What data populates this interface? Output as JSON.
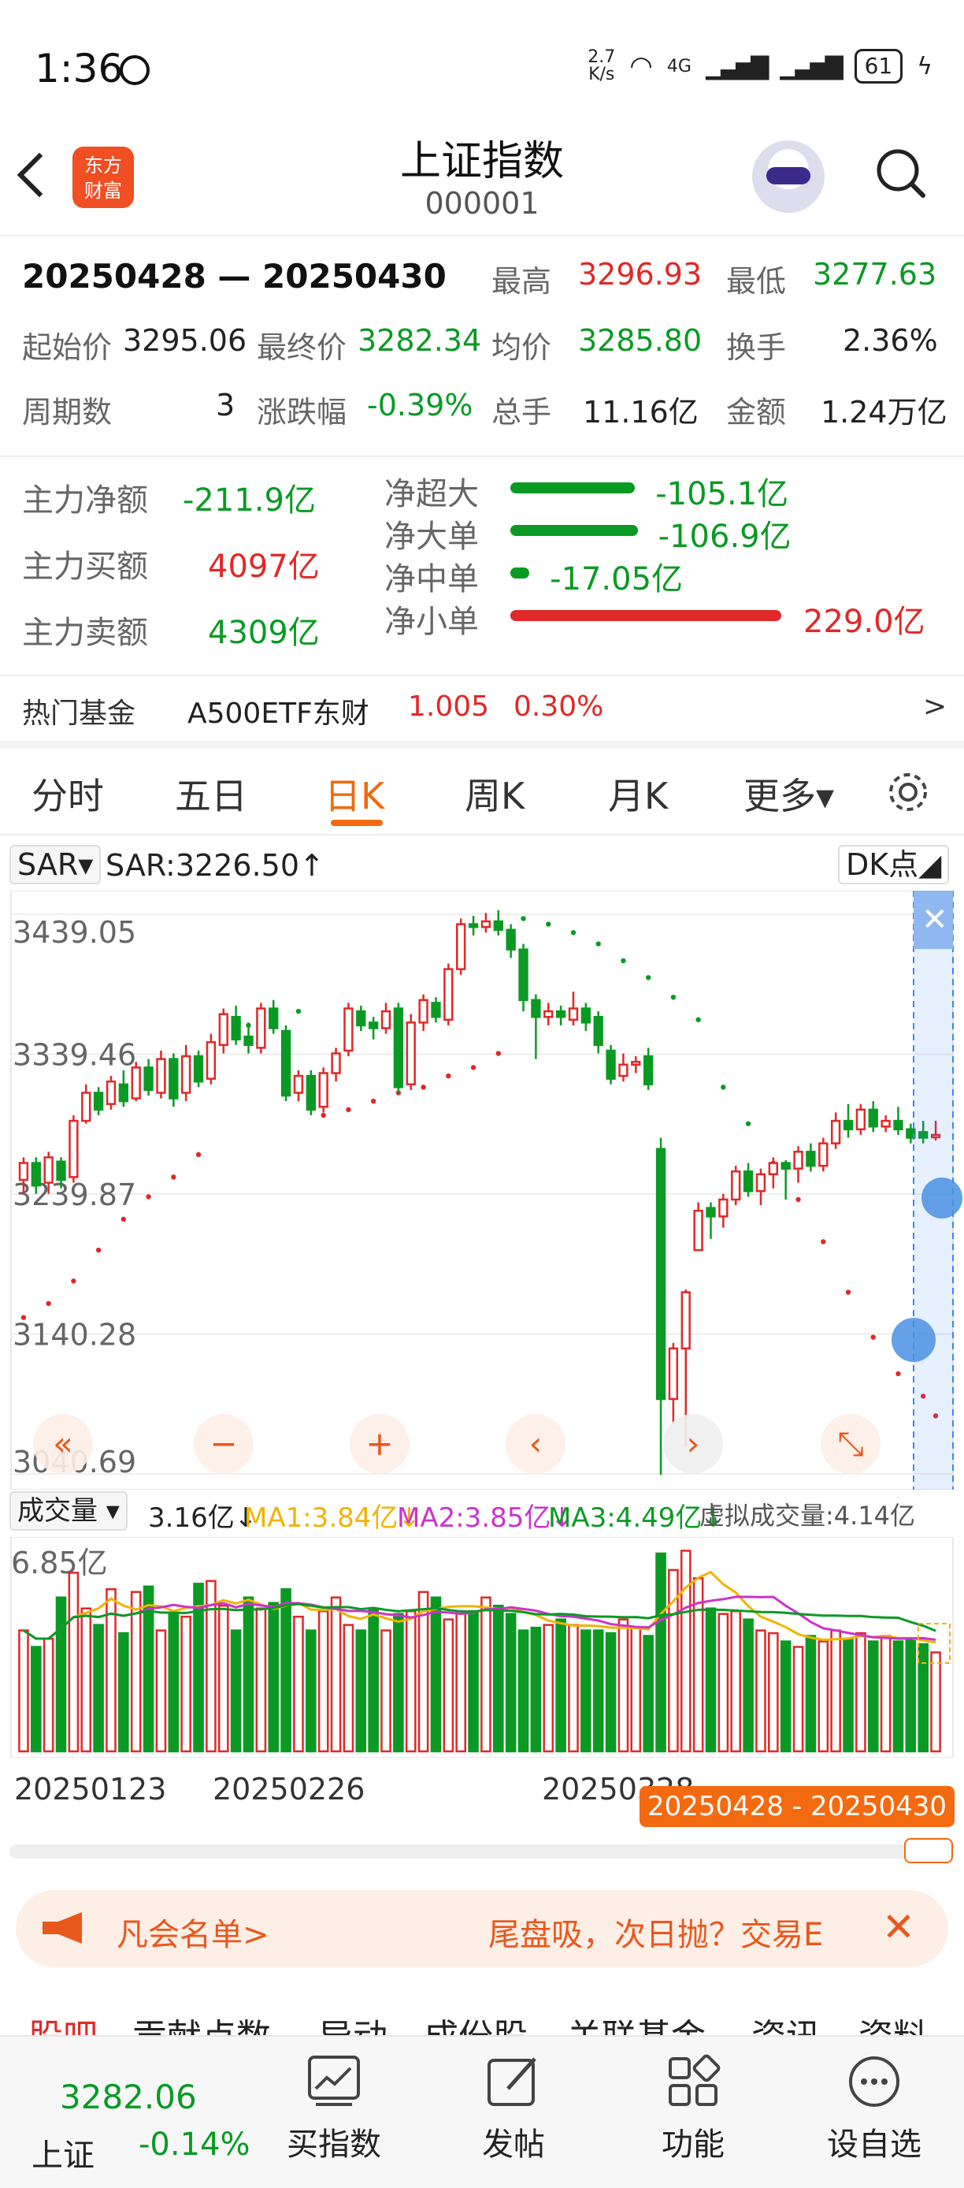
{
  "status": {
    "time": "1:36",
    "net_speed_top": "2.7",
    "net_speed_bottom": "K/s",
    "net": "4G",
    "battery": "61"
  },
  "header": {
    "logo_line1": "东方",
    "logo_line2": "财富",
    "title": "上证指数",
    "code": "000001"
  },
  "summary": {
    "range": "20250428 — 20250430",
    "high_label": "最高",
    "high": "3296.93",
    "low_label": "最低",
    "low": "3277.63",
    "open_label": "起始价",
    "open": "3295.06",
    "close_label": "最终价",
    "close": "3282.34",
    "avg_label": "均价",
    "avg": "3285.80",
    "turnover_label": "换手",
    "turnover": "2.36%",
    "period_label": "周期数",
    "period": "3",
    "change_label": "涨跌幅",
    "change": "-0.39%",
    "volume_label": "总手",
    "volume": "11.16亿",
    "amount_label": "金额",
    "amount": "1.24万亿"
  },
  "flow": {
    "main_net_label": "主力净额",
    "main_net": "-211.9亿",
    "main_buy_label": "主力买额",
    "main_buy": "4097亿",
    "main_sell_label": "主力卖额",
    "main_sell": "4309亿",
    "items": [
      {
        "label": "净超大",
        "value": "-105.1亿",
        "ratio": 0.46,
        "color": "#0a9a24"
      },
      {
        "label": "净大单",
        "value": "-106.9亿",
        "ratio": 0.47,
        "color": "#0a9a24"
      },
      {
        "label": "净中单",
        "value": "-17.05亿",
        "ratio": 0.07,
        "color": "#0a9a24"
      },
      {
        "label": "净小单",
        "value": "229.0亿",
        "ratio": 1.0,
        "color": "#e02828"
      }
    ]
  },
  "hot_fund": {
    "label": "热门基金",
    "name": "A500ETF东财",
    "price": "1.005",
    "change": "0.30%",
    "arrow": ">"
  },
  "tabs": [
    "分时",
    "五日",
    "日K",
    "周K",
    "月K",
    "更多▾"
  ],
  "active_tab": "日K",
  "indicator": {
    "name": "SAR▾",
    "value": "SAR:3226.50↑",
    "dk": "DK点◢"
  },
  "chart_data": {
    "type": "candlestick",
    "y_ticks": [
      "3439.05",
      "3339.46",
      "3239.87",
      "3140.28",
      "3040.69"
    ],
    "ylim": [
      3040.69,
      3439.05
    ],
    "candles": [
      [
        3250,
        3262,
        3240,
        3266
      ],
      [
        3262,
        3246,
        3240,
        3266
      ],
      [
        3248,
        3266,
        3240,
        3270
      ],
      [
        3263,
        3250,
        3244,
        3266
      ],
      [
        3252,
        3292,
        3248,
        3296
      ],
      [
        3292,
        3312,
        3290,
        3318
      ],
      [
        3312,
        3300,
        3296,
        3316
      ],
      [
        3304,
        3320,
        3300,
        3324
      ],
      [
        3318,
        3306,
        3302,
        3328
      ],
      [
        3308,
        3330,
        3306,
        3334
      ],
      [
        3330,
        3314,
        3310,
        3336
      ],
      [
        3312,
        3336,
        3308,
        3342
      ],
      [
        3336,
        3308,
        3302,
        3340
      ],
      [
        3312,
        3338,
        3306,
        3346
      ],
      [
        3338,
        3320,
        3316,
        3342
      ],
      [
        3322,
        3348,
        3318,
        3354
      ],
      [
        3346,
        3368,
        3340,
        3372
      ],
      [
        3366,
        3350,
        3346,
        3374
      ],
      [
        3352,
        3346,
        3340,
        3362
      ],
      [
        3344,
        3372,
        3340,
        3376
      ],
      [
        3372,
        3358,
        3354,
        3378
      ],
      [
        3356,
        3310,
        3306,
        3360
      ],
      [
        3312,
        3324,
        3306,
        3328
      ],
      [
        3324,
        3300,
        3296,
        3328
      ],
      [
        3302,
        3326,
        3298,
        3330
      ],
      [
        3326,
        3340,
        3320,
        3344
      ],
      [
        3342,
        3372,
        3338,
        3376
      ],
      [
        3370,
        3360,
        3356,
        3374
      ],
      [
        3362,
        3358,
        3350,
        3366
      ],
      [
        3358,
        3370,
        3354,
        3376
      ],
      [
        3372,
        3316,
        3312,
        3376
      ],
      [
        3318,
        3362,
        3314,
        3368
      ],
      [
        3362,
        3378,
        3356,
        3382
      ],
      [
        3376,
        3366,
        3362,
        3380
      ],
      [
        3364,
        3400,
        3360,
        3404
      ],
      [
        3400,
        3432,
        3396,
        3436
      ],
      [
        3432,
        3430,
        3424,
        3438
      ],
      [
        3430,
        3434,
        3426,
        3440
      ],
      [
        3434,
        3428,
        3424,
        3442
      ],
      [
        3428,
        3414,
        3408,
        3432
      ],
      [
        3414,
        3378,
        3370,
        3418
      ],
      [
        3378,
        3366,
        3336,
        3382
      ],
      [
        3366,
        3370,
        3360,
        3376
      ],
      [
        3370,
        3366,
        3360,
        3374
      ],
      [
        3364,
        3372,
        3360,
        3384
      ],
      [
        3372,
        3362,
        3356,
        3376
      ],
      [
        3366,
        3346,
        3340,
        3370
      ],
      [
        3342,
        3322,
        3318,
        3346
      ],
      [
        3324,
        3332,
        3320,
        3340
      ],
      [
        3332,
        3334,
        3326,
        3338
      ],
      [
        3338,
        3318,
        3314,
        3344
      ],
      [
        3272,
        3094,
        3040,
        3280
      ],
      [
        3094,
        3130,
        3076,
        3134
      ],
      [
        3130,
        3170,
        3060,
        3172
      ],
      [
        3200,
        3228,
        3218,
        3234
      ],
      [
        3230,
        3224,
        3208,
        3234
      ],
      [
        3224,
        3236,
        3216,
        3240
      ],
      [
        3236,
        3256,
        3232,
        3260
      ],
      [
        3256,
        3242,
        3238,
        3262
      ],
      [
        3242,
        3254,
        3232,
        3258
      ],
      [
        3254,
        3262,
        3244,
        3266
      ],
      [
        3262,
        3258,
        3236,
        3264
      ],
      [
        3258,
        3270,
        3248,
        3274
      ],
      [
        3270,
        3260,
        3256,
        3276
      ],
      [
        3260,
        3276,
        3256,
        3280
      ],
      [
        3276,
        3292,
        3272,
        3298
      ],
      [
        3292,
        3286,
        3280,
        3304
      ],
      [
        3286,
        3300,
        3282,
        3304
      ],
      [
        3300,
        3288,
        3284,
        3306
      ],
      [
        3288,
        3292,
        3284,
        3296
      ],
      [
        3292,
        3286,
        3282,
        3302
      ],
      [
        3286,
        3280,
        3276,
        3290
      ],
      [
        3284,
        3280,
        3276,
        3292
      ],
      [
        3282,
        3282,
        3278,
        3292
      ]
    ],
    "sar": [
      [
        0,
        3152
      ],
      [
        2,
        3162
      ],
      [
        4,
        3178
      ],
      [
        6,
        3200
      ],
      [
        8,
        3222
      ],
      [
        10,
        3238
      ],
      [
        12,
        3252
      ],
      [
        14,
        3268
      ],
      [
        16,
        3358
      ],
      [
        18,
        3360
      ],
      [
        20,
        3364
      ],
      [
        22,
        3370
      ],
      [
        24,
        3296
      ],
      [
        26,
        3300
      ],
      [
        28,
        3306
      ],
      [
        30,
        3312
      ],
      [
        32,
        3316
      ],
      [
        34,
        3324
      ],
      [
        36,
        3330
      ],
      [
        38,
        3340
      ],
      [
        40,
        3436
      ],
      [
        42,
        3432
      ],
      [
        44,
        3426
      ],
      [
        46,
        3418
      ],
      [
        48,
        3406
      ],
      [
        50,
        3394
      ],
      [
        52,
        3380
      ],
      [
        54,
        3364
      ],
      [
        56,
        3316
      ],
      [
        58,
        3290
      ],
      [
        60,
        3262
      ],
      [
        62,
        3236
      ],
      [
        64,
        3206
      ],
      [
        66,
        3170
      ],
      [
        68,
        3138
      ],
      [
        70,
        3112
      ],
      [
        72,
        3096
      ],
      [
        73,
        3082
      ]
    ],
    "volume_label": "成交量 ▾",
    "volume_value": "3.16亿↓",
    "ma1": "MA1:3.84亿↓",
    "ma2": "MA2:3.85亿↓",
    "ma3": "MA3:4.49亿↓",
    "virtual": "虚拟成交量:4.14亿",
    "vol_max": "6.85亿",
    "volumes": [
      4.4,
      3.8,
      4.1,
      5.6,
      6.5,
      5.2,
      4.6,
      5.9,
      4.3,
      5.8,
      6.0,
      4.4,
      5.0,
      4.9,
      6.1,
      6.2,
      5.3,
      4.4,
      5.6,
      5.2,
      5.4,
      5.9,
      4.9,
      4.4,
      5.1,
      5.6,
      4.6,
      4.4,
      5.2,
      4.4,
      5.0,
      5.1,
      5.8,
      5.6,
      4.8,
      5.1,
      5.1,
      5.6,
      5.3,
      5.0,
      4.4,
      4.5,
      4.6,
      4.8,
      4.6,
      4.4,
      4.4,
      4.3,
      4.8,
      4.5,
      4.2,
      7.2,
      6.6,
      7.3,
      6.3,
      5.2,
      5.0,
      5.1,
      4.8,
      4.4,
      4.3,
      4.0,
      3.8,
      4.2,
      4.0,
      4.4,
      4.1,
      4.3,
      4.0,
      4.2,
      4.0,
      4.1,
      3.9,
      3.6
    ],
    "x_ticks": [
      "20250123",
      "20250226",
      "20250328",
      "20250430"
    ],
    "selected_range": "20250428 - 20250430"
  },
  "chart_colors": {
    "up": "#e02828",
    "down": "#0a9a24",
    "ma1": "#f0b400",
    "ma2": "#cc33cc",
    "ma3": "#0a9a24"
  },
  "banner": {
    "left": "凡会名单>",
    "right": "尾盘吸，次日抛？交易E"
  },
  "subtabs": [
    "股吧",
    "贡献点数",
    "异动",
    "成份股",
    "关联基金",
    "资讯",
    "资料"
  ],
  "bottom": {
    "price": "3282.06",
    "name": "上证",
    "change": "-0.14%",
    "buy_label": "买指数",
    "post_label": "发帖",
    "func_label": "功能",
    "watch_label": "设自选"
  }
}
